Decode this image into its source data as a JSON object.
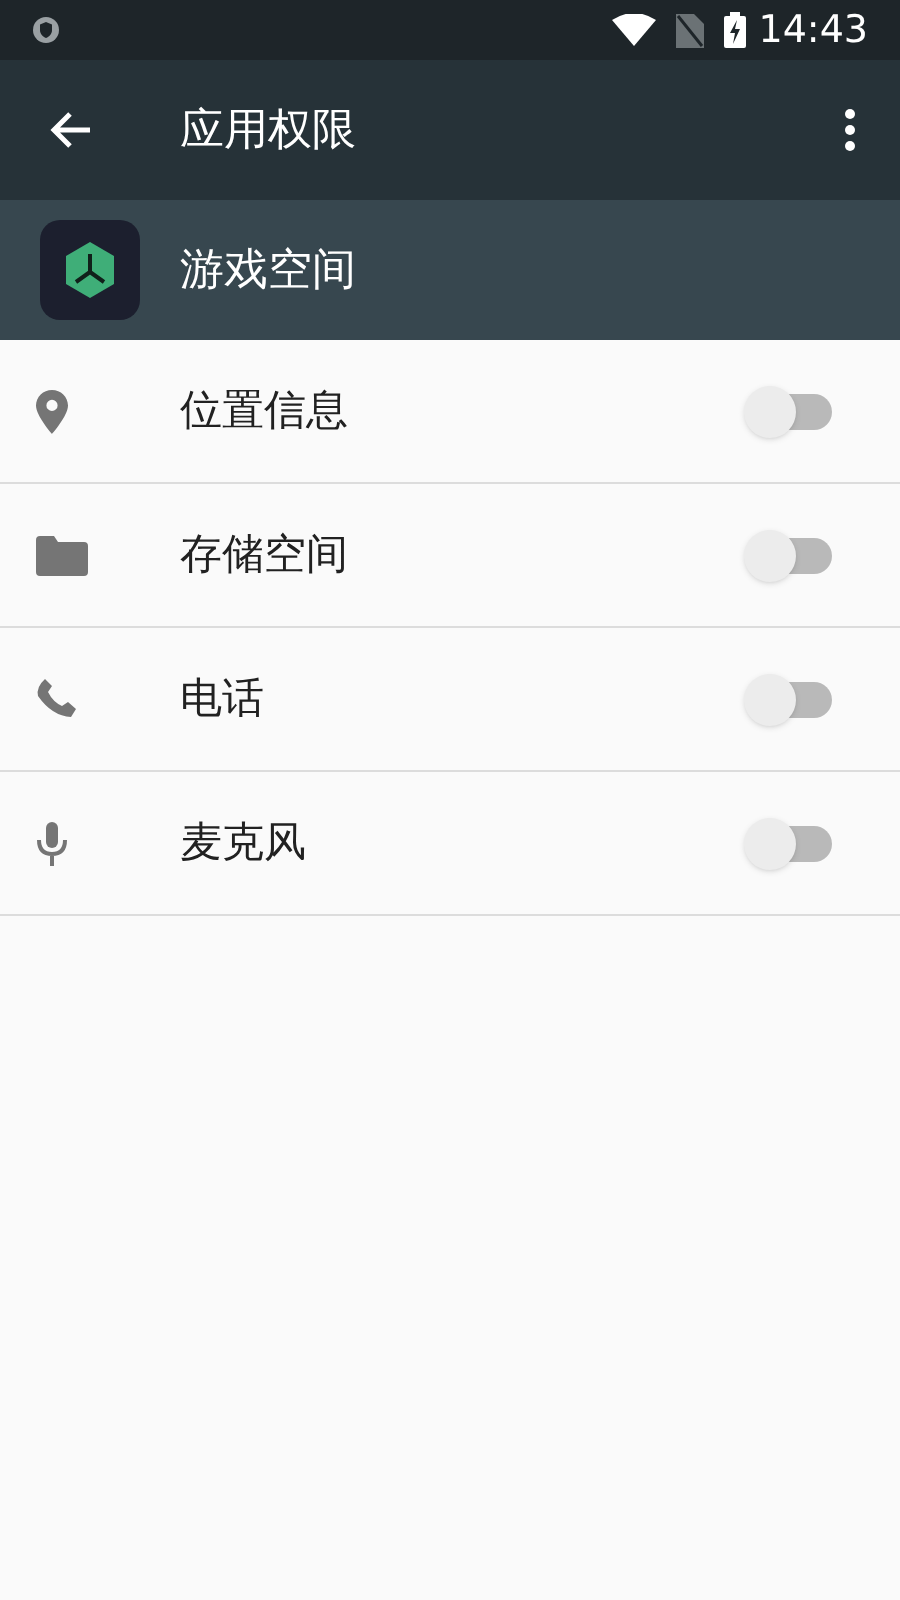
{
  "status_bar": {
    "time": "14:43"
  },
  "app_bar": {
    "title": "应用权限"
  },
  "app": {
    "name": "游戏空间"
  },
  "permissions": [
    {
      "label": "位置信息",
      "on": false
    },
    {
      "label": "存储空间",
      "on": false
    },
    {
      "label": "电话",
      "on": false
    },
    {
      "label": "麦克风",
      "on": false
    }
  ]
}
